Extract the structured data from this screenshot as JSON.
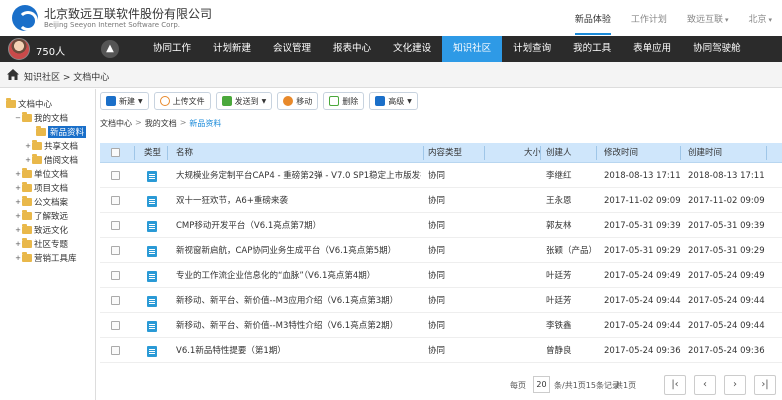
{
  "header": {
    "company_cn": "北京致远互联软件股份有限公司",
    "company_en": "Beijing Seeyon Internet Software Corp.",
    "links": [
      "新品体验",
      "工作计划",
      "致远互联",
      "北京"
    ],
    "active_link": "新品体验"
  },
  "navbar": {
    "points": "750人",
    "items": [
      "协同工作",
      "计划新建",
      "会议管理",
      "报表中心",
      "文化建设",
      "知识社区",
      "计划查询",
      "我的工具",
      "表单应用",
      "协同驾驶舱"
    ],
    "active_item": "知识社区",
    "accent_color": "#2e9ae6"
  },
  "breadcrumb": {
    "text": "知识社区 > 文档中心"
  },
  "sidebar": {
    "items": [
      {
        "label": "文档中心",
        "toggle": "",
        "level": 0
      },
      {
        "label": "我的文档",
        "toggle": "−",
        "level": 1
      },
      {
        "label": "新品资料",
        "toggle": "",
        "level": 2,
        "selected": true
      },
      {
        "label": "共享文档",
        "toggle": "+",
        "level": 1
      },
      {
        "label": "借阅文档",
        "toggle": "+",
        "level": 1
      },
      {
        "label": "单位文档",
        "toggle": "+",
        "level": 0
      },
      {
        "label": "项目文档",
        "toggle": "+",
        "level": 0
      },
      {
        "label": "公文档案",
        "toggle": "+",
        "level": 0
      },
      {
        "label": "了解致远",
        "toggle": "+",
        "level": 0
      },
      {
        "label": "致远文化",
        "toggle": "+",
        "level": 0
      },
      {
        "label": "社区专题",
        "toggle": "+",
        "level": 0
      },
      {
        "label": "营销工具库",
        "toggle": "+",
        "level": 0
      }
    ]
  },
  "toolbar": {
    "new": "新建",
    "upload": "上传文件",
    "send": "发送到",
    "move": "移动",
    "delete": "删除",
    "advanced": "高级"
  },
  "path": {
    "root": "文档中心",
    "mid": "我的文档",
    "current": "新品资料"
  },
  "table": {
    "headers": {
      "type": "类型",
      "name": "名称",
      "content_type": "内容类型",
      "size": "大小",
      "creator": "创建人",
      "modified": "修改时间",
      "created": "创建时间"
    },
    "rows": [
      {
        "name": "大规模业务定制平台CAP4 - 重磅第2弹 - V7.0 SP1稳定上市版发布!",
        "content_type": "协同",
        "creator": "李继红",
        "modified": "2018-08-13 17:11",
        "created": "2018-08-13 17:11"
      },
      {
        "name": "双十一狂欢节，A6+重磅来袭",
        "content_type": "协同",
        "creator": "王永恩",
        "modified": "2017-11-02 09:09",
        "created": "2017-11-02 09:09"
      },
      {
        "name": "CMP移动开发平台（V6.1亮点第7期）",
        "content_type": "协同",
        "creator": "郭友林",
        "modified": "2017-05-31 09:39",
        "created": "2017-05-31 09:39"
      },
      {
        "name": "新视窗新启航，CAP协同业务生成平台（V6.1亮点第5期）",
        "content_type": "协同",
        "creator": "张颖（产品）",
        "modified": "2017-05-31 09:29",
        "created": "2017-05-31 09:29"
      },
      {
        "name": "专业的工作流企业信息化的“血脉”（V6.1亮点第4期）",
        "content_type": "协同",
        "creator": "叶廷芳",
        "modified": "2017-05-24 09:49",
        "created": "2017-05-24 09:49"
      },
      {
        "name": "新移动、新平台、新价值--M3应用介绍（V6.1亮点第3期）",
        "content_type": "协同",
        "creator": "叶廷芳",
        "modified": "2017-05-24 09:44",
        "created": "2017-05-24 09:44"
      },
      {
        "name": "新移动、新平台、新价值--M3特性介绍（V6.1亮点第2期）",
        "content_type": "协同",
        "creator": "李铁鑫",
        "modified": "2017-05-24 09:44",
        "created": "2017-05-24 09:44"
      },
      {
        "name": "V6.1新品特性提要（第1期）",
        "content_type": "协同",
        "creator": "曾静良",
        "modified": "2017-05-24 09:36",
        "created": "2017-05-24 09:36"
      }
    ]
  },
  "pager": {
    "label_per_page": "每页",
    "page_size": "20",
    "summary": "条/共1页15条记录",
    "pages": "共1页"
  }
}
